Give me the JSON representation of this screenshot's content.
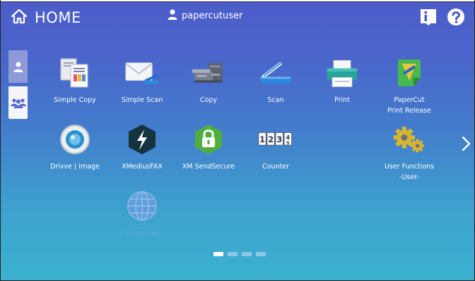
{
  "header": {
    "home_label": "HOME",
    "user_name": "papercutuser",
    "icons": {
      "home": "home-icon",
      "user": "user-icon",
      "info": "info-icon",
      "help": "help-icon"
    }
  },
  "side_tabs": [
    {
      "name": "personal",
      "icon": "person-icon",
      "active": true
    },
    {
      "name": "shared",
      "icon": "group-icon",
      "active": false
    }
  ],
  "apps": [
    {
      "label": "Simple Copy",
      "icon": "simple-copy-icon"
    },
    {
      "label": "Simple Scan",
      "icon": "simple-scan-icon"
    },
    {
      "label": "Copy",
      "icon": "copier-icon"
    },
    {
      "label": "Scan",
      "icon": "scanner-icon"
    },
    {
      "label": "Print",
      "icon": "printer-icon"
    },
    {
      "label": "PaperCut\nPrint Release",
      "icon": "papercut-icon"
    },
    {
      "label": "Drivve | Image",
      "icon": "drivve-icon"
    },
    {
      "label": "XMediusFAX",
      "icon": "xmedius-fax-icon"
    },
    {
      "label": "XM SendSecure",
      "icon": "sendsecure-lock-icon"
    },
    {
      "label": "Counter",
      "icon": "counter-icon"
    },
    {
      "label": "User Functions\n-User-",
      "icon": "gears-icon"
    },
    {
      "label": "Language",
      "icon": "globe-icon",
      "disabled": true
    }
  ],
  "pager": {
    "pages": 4,
    "current": 1
  },
  "colors": {
    "background_top": "#4d5cc9",
    "background_bottom": "#3bb1cf",
    "text": "#ffffff"
  }
}
